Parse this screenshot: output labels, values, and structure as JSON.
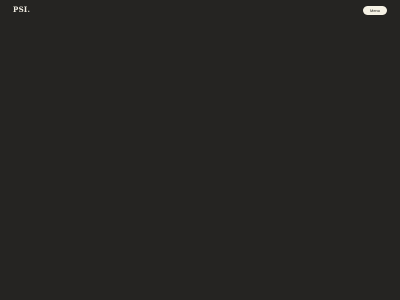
{
  "header": {
    "logo_text": "PSI.",
    "menu_label": "Menu"
  },
  "colors": {
    "background": "#252422",
    "logo": "#f0ece2",
    "button_background": "#f5f1e4",
    "button_text": "#1c1b19"
  }
}
